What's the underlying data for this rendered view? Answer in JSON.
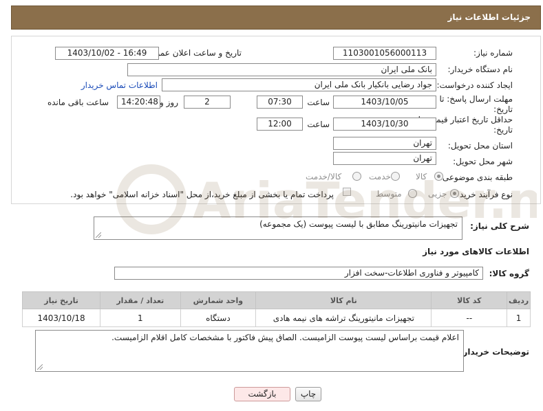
{
  "header": {
    "title": "جزئیات اطلاعات نیاز"
  },
  "fields": {
    "need_number_label": "شماره نیاز:",
    "need_number": "1103001056000113",
    "announce_label": "تاریخ و ساعت اعلان عمومی:",
    "announce_value": "1403/10/02 - 16:49",
    "buyer_org_label": "نام دستگاه خریدار:",
    "buyer_org": "بانک ملی ایران",
    "requester_label": "ایجاد کننده درخواست:",
    "requester": "جواد رضایی بانکیار بانک ملی ایران",
    "contact_link": "اطلاعات تماس خریدار",
    "deadline_label_1": "مهلت ارسال پاسخ: تا",
    "deadline_label_2": "تاریخ:",
    "deadline_date": "1403/10/05",
    "time_label": "ساعت",
    "deadline_time": "07:30",
    "days_value": "2",
    "days_label": "روز و",
    "remaining_time": "14:20:48",
    "remaining_label": "ساعت باقی مانده",
    "validity_label_1": "حداقل تاریخ اعتبار قیمت: تا",
    "validity_label_2": "تاریخ:",
    "validity_date": "1403/10/30",
    "validity_time_label": "ساعت",
    "validity_time": "12:00",
    "province_label": "استان محل تحویل:",
    "province": "تهران",
    "city_label": "شهر محل تحویل:",
    "city": "تهران",
    "category_label": "طبقه بندی موضوعی:",
    "category_options": [
      "کالا",
      "خدمت",
      "کالا/خدمت"
    ],
    "process_label": "نوع فرآیند خرید :",
    "process_options": [
      "جزیی",
      "متوسط"
    ],
    "payment_note": "پرداخت تمام یا بخشی از مبلغ خرید،از محل \"اسناد خزانه اسلامی\" خواهد بود."
  },
  "description": {
    "label": "شرح کلی نیاز:",
    "value": "تجهیزات مانیتورینگ مطابق با لیست پیوست (یک مجموعه)"
  },
  "goods_section": {
    "title": "اطلاعات کالاهای مورد نیاز",
    "group_label": "گروه کالا:",
    "group_value": "کامپیوتر و فناوری اطلاعات-سخت افزار"
  },
  "table": {
    "headers": [
      "ردیف",
      "کد کالا",
      "نام کالا",
      "واحد شمارش",
      "تعداد / مقدار",
      "تاریخ نیاز"
    ],
    "rows": [
      [
        "1",
        "--",
        "تجهیزات مانیتورینگ تراشه های نیمه هادی",
        "دستگاه",
        "1",
        "1403/10/18"
      ]
    ]
  },
  "buyer_notes": {
    "label": "توضیحات خریدار:",
    "value": "اعلام قیمت براساس لیست پیوست  الزامیست. الصاق پیش فاکتور با مشخصات کامل اقلام الزامیست."
  },
  "buttons": {
    "print": "چاپ",
    "back": "بازگشت"
  },
  "watermark": {
    "text": "AriaTender.neT"
  }
}
